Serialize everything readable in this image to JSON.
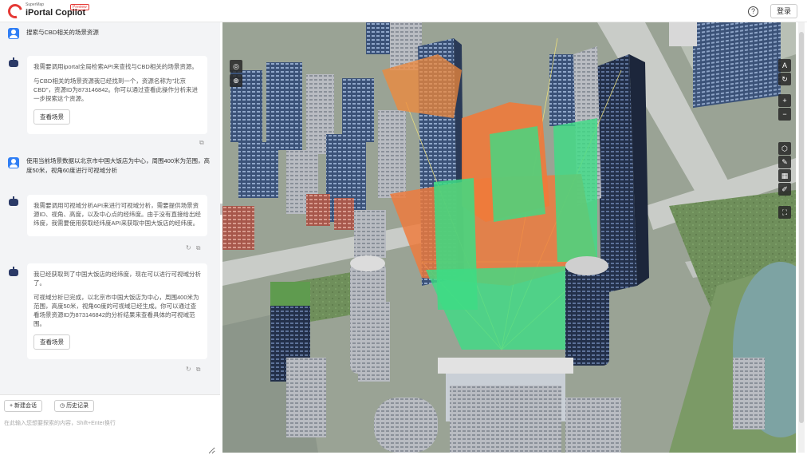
{
  "header": {
    "brand_small": "SuperMap",
    "brand_title": "iPortal Copilot",
    "brand_badge": "Preview",
    "help_icon": "?",
    "login_label": "登录"
  },
  "chat": {
    "messages": [
      {
        "role": "user",
        "text": "搜索与CBD相关的场景资源"
      },
      {
        "role": "bot",
        "paragraphs": [
          "我需要调用iportal全局检索API来查找与CBD相关的场景资源。",
          "与CBD相关的场景资源我已经找到一个，资源名称为\"北京CBD\"，资源ID为873146842。你可以通过查看此操作分析来进一步探索这个资源。"
        ],
        "button": "查看场景"
      },
      {
        "role": "user",
        "text": "使用当前场景数据以北京市中国大饭店为中心，周围400米为范围，高度50米，视角60度进行可视域分析"
      },
      {
        "role": "bot",
        "paragraphs": [
          "我需要调用可视域分析API来进行可视域分析，需要提供场景资源ID、视角、高度，以及中心点的经纬度。由于没有直接给出经纬度，我需要使用获取经纬度API来获取中国大饭店的经纬度。"
        ]
      },
      {
        "role": "bot",
        "paragraphs": [
          "我已经获取到了中国大饭店的经纬度，现在可以进行可视域分析了。",
          "可视域分析已完成，以北京市中国大饭店为中心，周围400米为范围，高度50米，视角60度的可视域已经生成。你可以通过查看场景资源ID为873146842的分析结果来查看具体的可视域范围。"
        ],
        "button": "查看场景"
      }
    ],
    "actions": {
      "copy_icon": "copy-icon",
      "regenerate_icon": "refresh-icon"
    },
    "footer": {
      "new_chat_label": "+ 新建会话",
      "history_label": "历史记录",
      "input_placeholder": "在此输入您想要探索的内容，Shift+Enter换行",
      "send_icon": "send-icon"
    }
  },
  "map": {
    "tools_left": [
      "compass-icon",
      "location-icon"
    ],
    "tools_right_top": [
      "font-icon",
      "refresh-icon",
      "zoom-in-icon",
      "zoom-out-icon"
    ],
    "tools_right_mid": [
      "cube-icon",
      "ruler-icon",
      "grid-icon",
      "draw-icon"
    ],
    "tools_right_bottom": [
      "fullscreen-icon"
    ],
    "colors": {
      "visible": "#3ddc84",
      "invisible": "#f07a3a"
    }
  }
}
